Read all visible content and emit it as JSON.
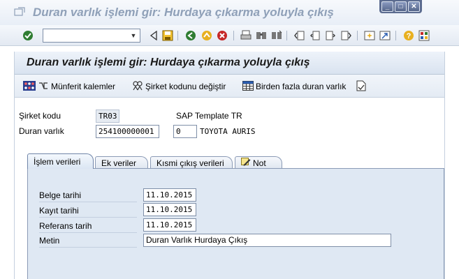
{
  "window": {
    "title": "Duran varlık işlemi gir: Hurdaya çıkarma yoluyla çıkış",
    "controls": {
      "minimize": "_",
      "maximize": "□",
      "close": "✕"
    }
  },
  "toolbar": {
    "command_field_value": "",
    "icons": [
      "enter-icon",
      "back-icon",
      "save-icon",
      "green-back-icon",
      "exit-icon",
      "cancel-icon",
      "print-icon",
      "find-icon",
      "find-next-icon",
      "first-page-icon",
      "previous-page-icon",
      "next-page-icon",
      "last-page-icon",
      "new-session-icon",
      "shortcut-icon",
      "help-icon",
      "customize-layout-icon"
    ]
  },
  "screen": {
    "title": "Duran varlık işlemi gir: Hurdaya çıkarma yoluyla çıkış",
    "app_toolbar": {
      "line_items": "Münferit kalemler",
      "change_company": "Şirket kodunu değiştir",
      "multiple_assets": "Birden fazla duran varlık"
    },
    "header": {
      "company_code_label": "Şirket kodu",
      "company_code_value": "TR03",
      "company_name": "SAP Template TR",
      "asset_label": "Duran varlık",
      "asset_value": "254100000001",
      "sub_number": "0",
      "asset_description": "TOYOTA AURIS"
    },
    "tabs": [
      {
        "label": "İşlem verileri",
        "active": true
      },
      {
        "label": "Ek veriler",
        "active": false
      },
      {
        "label": "Kısmi çıkış verileri",
        "active": false
      },
      {
        "label": "Not",
        "active": false
      }
    ],
    "transaction_data": {
      "document_date_label": "Belge tarihi",
      "document_date": "11.10.2015",
      "posting_date_label": "Kayıt tarihi",
      "posting_date": "11.10.2015",
      "reference_date_label": "Referans tarih",
      "reference_date": "11.10.2015",
      "text_label": "Metin",
      "text_value": "Duran Varlık Hurdaya Çıkış"
    }
  }
}
